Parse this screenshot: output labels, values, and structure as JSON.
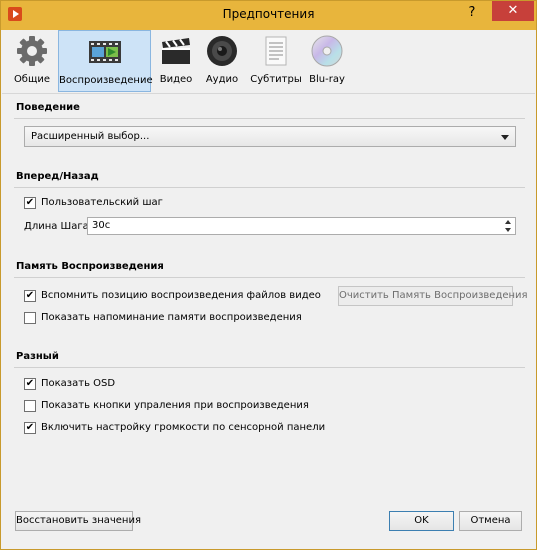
{
  "window": {
    "title": "Предпочтения",
    "help_label": "?",
    "close_label": "✕"
  },
  "toolbar": {
    "tabs": [
      {
        "label": "Общие",
        "icon": "gear-icon"
      },
      {
        "label": "Воспроизведение",
        "icon": "filmstrip-icon"
      },
      {
        "label": "Видео",
        "icon": "clapperboard-icon"
      },
      {
        "label": "Аудио",
        "icon": "speaker-icon"
      },
      {
        "label": "Субтитры",
        "icon": "document-icon"
      },
      {
        "label": "Blu-ray",
        "icon": "disc-icon"
      }
    ],
    "active_tab": "Воспроизведение"
  },
  "behavior": {
    "title": "Поведение",
    "select_value": "Расширенный выбор..."
  },
  "seek": {
    "title": "Вперед/Назад",
    "custom_step_label": "Пользовательский шаг",
    "custom_step_checked": true,
    "step_length_label": "Длина Шага:",
    "step_length_value": "30с"
  },
  "memory": {
    "title": "Память Воспроизведения",
    "remember_label": "Вспомнить позицию воспроизведения файлов видео",
    "remember_checked": true,
    "clear_button": "Очистить Память Воспроизведения",
    "reminder_label": "Показать напоминание памяти воспроизведения",
    "reminder_checked": false
  },
  "misc": {
    "title": "Разный",
    "osd_label": "Показать OSD",
    "osd_checked": true,
    "controls_label": "Показать кнопки упраления при воспроизведения",
    "controls_checked": false,
    "touch_volume_label": "Включить настройку громкости по сенсорной панели",
    "touch_volume_checked": true
  },
  "footer": {
    "restore_button": "Восстановить значения",
    "ok_button": "OK",
    "cancel_button": "Отмена"
  },
  "colors": {
    "titlebar": "#e8b53c",
    "close_button": "#c7403a",
    "active_tab": "#cde3f7"
  }
}
